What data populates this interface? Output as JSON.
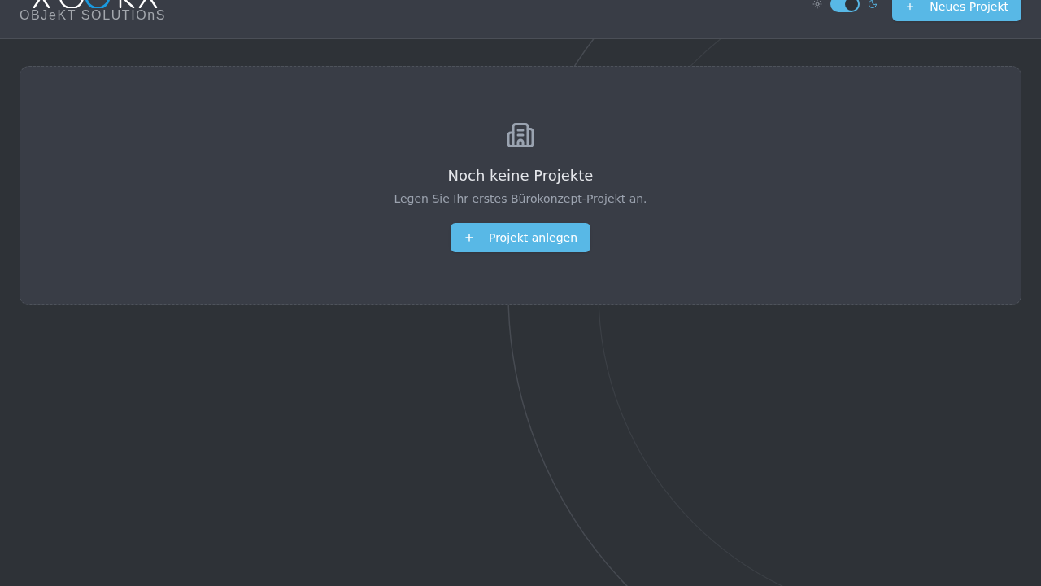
{
  "header": {
    "logo": {
      "subtitle": "OBJeKT SOLUTIOnS"
    },
    "theme_toggle": {
      "on": true
    },
    "new_project_button": {
      "label": "Neues Projekt"
    }
  },
  "empty_state": {
    "title": "Noch keine Projekte",
    "message": "Legen Sie Ihr erstes Bürokonzept-Projekt an.",
    "button": {
      "label": "Projekt anlegen"
    }
  }
}
